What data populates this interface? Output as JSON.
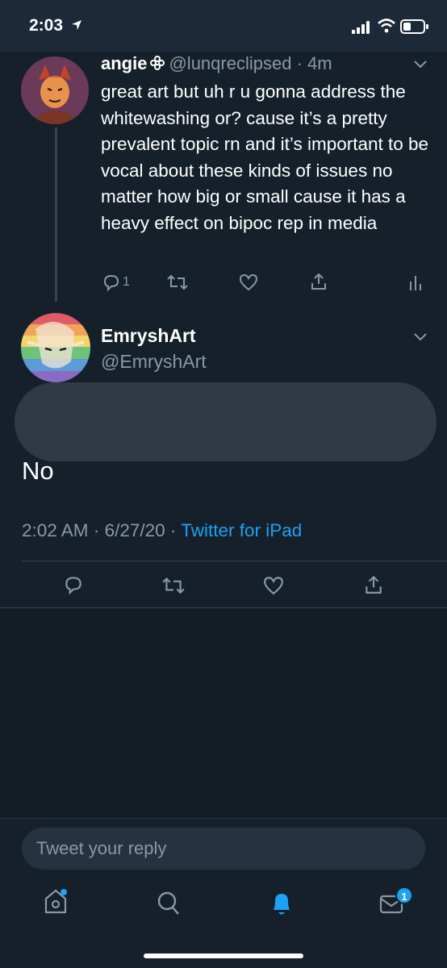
{
  "status_bar": {
    "time": "2:03"
  },
  "reply_tweet": {
    "name": "angie",
    "handle": "@lunqreclipsed",
    "age": "4m",
    "text": "great art but uh r u gonna address the whitewashing or? cause it’s a pretty prevalent topic rn and it’s important to be vocal about these kinds of issues no matter how big or small cause it has a heavy effect on bipoc rep in media",
    "reply_count": "1"
  },
  "main_tweet": {
    "name": "EmryshArt",
    "handle": "@EmryshArt",
    "text": "No",
    "time": "2:02 AM",
    "date": "6/27/20",
    "source": "Twitter for iPad"
  },
  "reply_box": {
    "placeholder": "Tweet your reply"
  },
  "tab_bar": {
    "messages_badge": "1"
  },
  "colors": {
    "background": "#15202b",
    "accent": "#1da1f2",
    "muted": "#8899a6",
    "divider": "#38444d"
  }
}
